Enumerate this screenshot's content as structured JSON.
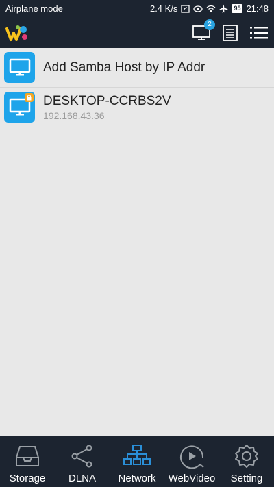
{
  "status": {
    "mode": "Airplane mode",
    "speed": "2.4 K/s",
    "battery": "95",
    "time": "21:48"
  },
  "app_bar": {
    "badge_count": "2"
  },
  "list": [
    {
      "title": "Add Samba Host by IP Addr",
      "subtitle": ""
    },
    {
      "title": "DESKTOP-CCRBS2V",
      "subtitle": "192.168.43.36"
    }
  ],
  "nav": [
    {
      "label": "Storage",
      "icon": "storage-icon"
    },
    {
      "label": "DLNA",
      "icon": "share-icon"
    },
    {
      "label": "Network",
      "icon": "network-icon",
      "active": true
    },
    {
      "label": "WebVideo",
      "icon": "play-icon"
    },
    {
      "label": "Setting",
      "icon": "gear-icon"
    }
  ],
  "colors": {
    "bar": "#1c2430",
    "accent": "#1ea4ea",
    "active_nav_icon": "#2a8fd8",
    "lock": "#f5a623"
  }
}
